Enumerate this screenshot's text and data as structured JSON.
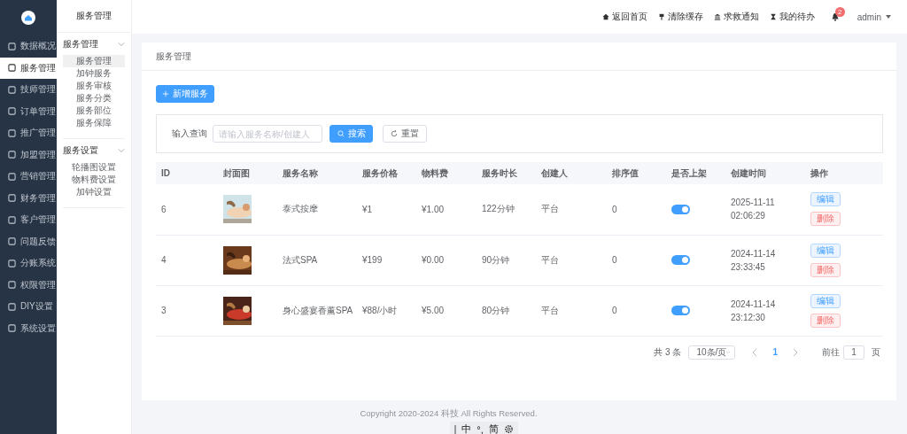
{
  "sidebar": {
    "items": [
      {
        "label": "数据概况",
        "selected": false
      },
      {
        "label": "服务管理",
        "selected": true
      },
      {
        "label": "技师管理",
        "selected": false
      },
      {
        "label": "订单管理",
        "selected": false
      },
      {
        "label": "推广管理",
        "selected": false
      },
      {
        "label": "加盟管理",
        "selected": false
      },
      {
        "label": "营销管理",
        "selected": false
      },
      {
        "label": "财务管理",
        "selected": false
      },
      {
        "label": "客户管理",
        "selected": false
      },
      {
        "label": "问题反馈",
        "selected": false
      },
      {
        "label": "分账系统",
        "selected": false
      },
      {
        "label": "权限管理",
        "selected": false
      },
      {
        "label": "DIY设置",
        "selected": false
      },
      {
        "label": "系统设置",
        "selected": false
      }
    ]
  },
  "submenu": {
    "title": "服务管理",
    "groups": [
      {
        "title": "服务管理",
        "expanded": true,
        "items": [
          {
            "label": "服务管理",
            "selected": true
          },
          {
            "label": "加钟服务",
            "selected": false
          },
          {
            "label": "服务审核",
            "selected": false
          },
          {
            "label": "服务分类",
            "selected": false
          },
          {
            "label": "服务部位",
            "selected": false
          },
          {
            "label": "服务保障",
            "selected": false
          }
        ]
      },
      {
        "title": "服务设置",
        "expanded": true,
        "items": [
          {
            "label": "轮播图设置",
            "selected": false
          },
          {
            "label": "物料费设置",
            "selected": false
          },
          {
            "label": "加钟设置",
            "selected": false
          }
        ]
      }
    ]
  },
  "header": {
    "links": [
      {
        "kind": "home",
        "label": "返回首页"
      },
      {
        "kind": "pin",
        "label": "清除缓存"
      },
      {
        "kind": "bank",
        "label": "求救通知"
      },
      {
        "kind": "hourglass",
        "label": "我的待办"
      }
    ],
    "notification_count": "2",
    "user": "admin"
  },
  "page": {
    "title": "服务管理",
    "add_button": "新增服务",
    "search": {
      "label": "输入查询",
      "placeholder": "请输入服务名称/创建人",
      "search_button": "搜索",
      "reset_button": "重置"
    },
    "table": {
      "columns": [
        "ID",
        "封面图",
        "服务名称",
        "服务价格",
        "物料费",
        "服务时长",
        "创建人",
        "排序值",
        "是否上架",
        "创建时间",
        "操作"
      ],
      "rows": [
        {
          "id": "6",
          "cover": {
            "kind": "picture"
          },
          "name": "泰式按摩",
          "price": "¥1",
          "material_fee": "¥1.00",
          "duration": "122分钟",
          "creator": "平台",
          "sort": "0",
          "on": true,
          "created": [
            "2025-11-11",
            "02:06:29"
          ],
          "actions": [
            "编辑",
            "删除"
          ]
        },
        {
          "id": "4",
          "cover": {
            "kind": "picture"
          },
          "name": "法式SPA",
          "price": "¥199",
          "material_fee": "¥0.00",
          "duration": "90分钟",
          "creator": "平台",
          "sort": "0",
          "on": true,
          "created": [
            "2024-11-14",
            "23:33:45"
          ],
          "actions": [
            "编辑",
            "删除"
          ]
        },
        {
          "id": "3",
          "cover": {
            "kind": "picture"
          },
          "name": "身心盛宴香薰SPA",
          "price": "¥88/小时",
          "material_fee": "¥5.00",
          "duration": "80分钟",
          "creator": "平台",
          "sort": "0",
          "on": true,
          "created": [
            "2024-11-14",
            "23:12:30"
          ],
          "actions": [
            "编辑",
            "删除"
          ]
        }
      ]
    },
    "pagination": {
      "total": "共 3 条",
      "page_size": "10条/页",
      "pages": [
        {
          "label": "1",
          "selected": true
        }
      ],
      "goto_label": "前往",
      "goto_value": "1",
      "page_suffix": "页"
    }
  },
  "footer": {
    "copyright": "Copyright 2020-2024 科技 All Rights Reserved."
  },
  "ime_bar": {
    "items": [
      "中",
      "°,",
      "简"
    ]
  }
}
